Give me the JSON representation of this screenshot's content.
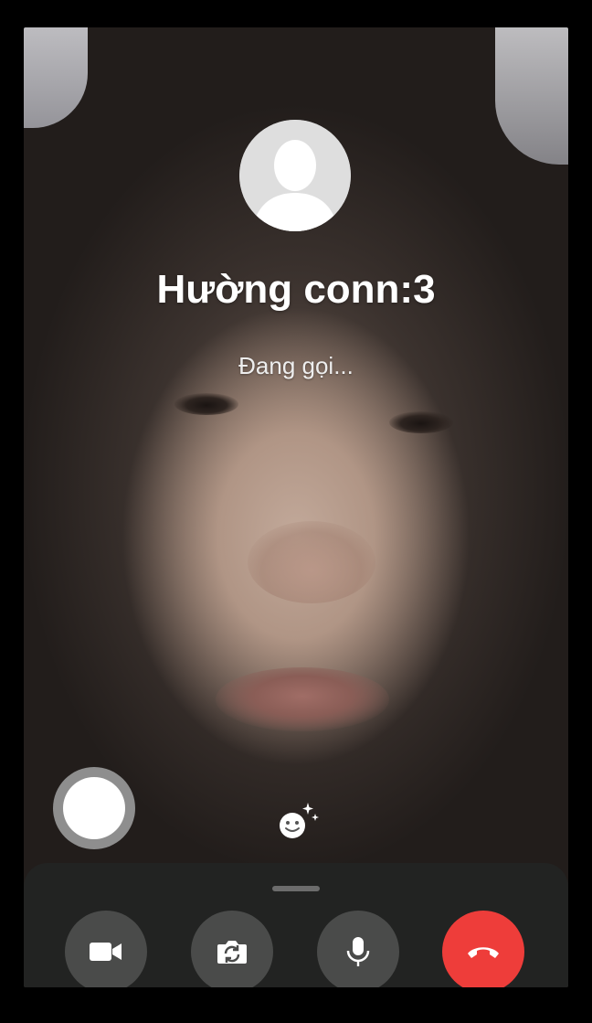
{
  "call": {
    "caller_name": "Hường conn:3",
    "status": "Đang gọi..."
  },
  "icons": {
    "avatar": "default-person-avatar",
    "capture": "shutter-circle",
    "effects": "smiley-sparkle-icon",
    "video": "video-camera-icon",
    "flip": "camera-flip-icon",
    "mic": "microphone-icon",
    "end": "phone-hangup-icon"
  },
  "colors": {
    "end_call": "#ee3d3a",
    "control_bar": "#222322",
    "control_button": "#4a4b4a"
  }
}
